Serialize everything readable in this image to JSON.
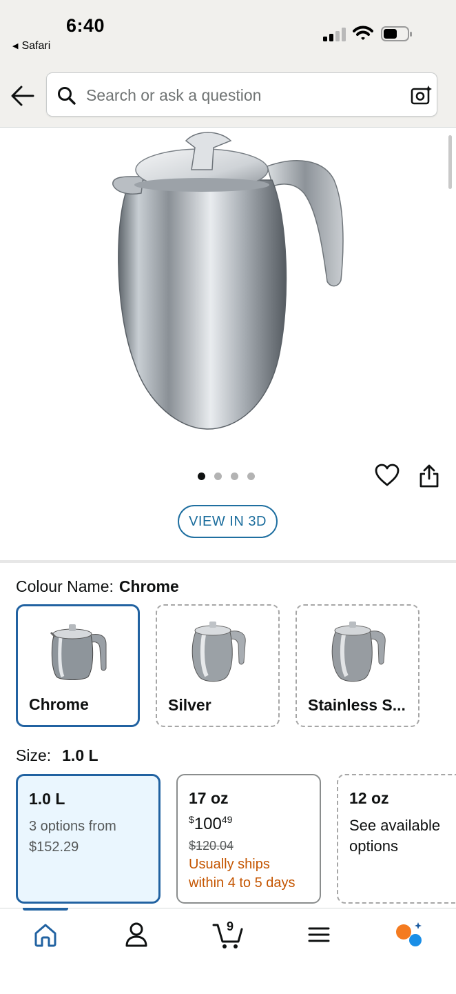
{
  "status_bar": {
    "time": "6:40",
    "back_app": "Safari"
  },
  "search": {
    "placeholder": "Search or ask a question"
  },
  "gallery": {
    "page_count": 4,
    "active_page": 1,
    "view_3d_label": "VIEW IN 3D"
  },
  "colour": {
    "label": "Colour Name:",
    "selected": "Chrome",
    "options": [
      {
        "name": "Chrome",
        "state": "selected"
      },
      {
        "name": "Silver",
        "state": "available"
      },
      {
        "name": "Stainless S...",
        "state": "available"
      }
    ]
  },
  "size": {
    "label": "Size:",
    "selected": "1.0 L",
    "options": [
      {
        "title": "1.0 L",
        "line1": "3 options from",
        "line2": "$152.29"
      },
      {
        "title": "17 oz",
        "price_symbol": "$",
        "price_whole": "100",
        "price_fraction": "49",
        "was_price": "$120.04",
        "ship_line1": "Usually ships",
        "ship_line2": "within 4 to 5 days"
      },
      {
        "title": "12 oz",
        "line1": "See available",
        "line2": "options"
      }
    ]
  },
  "nav": {
    "cart_count": "9",
    "items": [
      "home-icon",
      "account-icon",
      "cart-icon",
      "menu-icon",
      "rufus-icon"
    ],
    "accent": "#2162a1",
    "rufus_orange": "#f47b20",
    "rufus_blue": "#1a8ee6"
  },
  "colors": {
    "link_blue": "#1a6c9c",
    "ship_orange": "#c45500",
    "selected_border": "#2162a1"
  }
}
